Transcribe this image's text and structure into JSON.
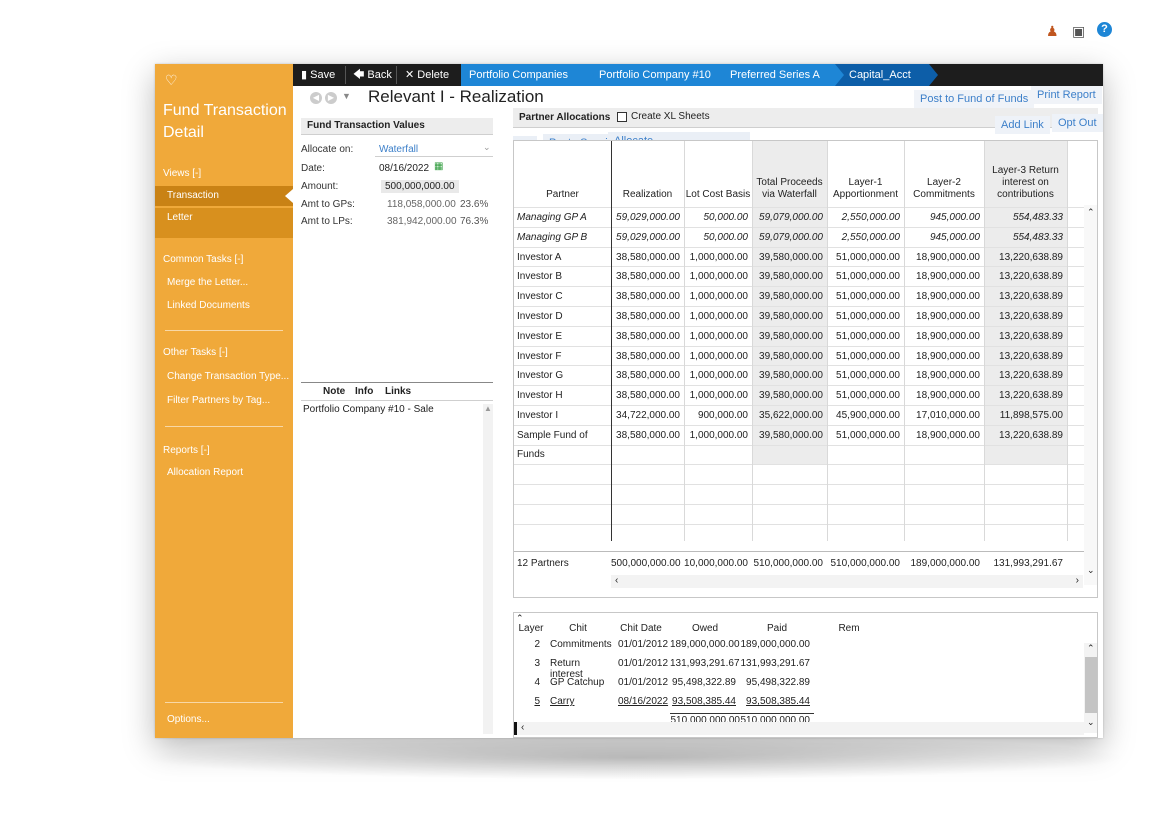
{
  "top_icons": {
    "user_icon": "person-icon",
    "camera_icon": "camera-icon",
    "help_icon": "help-icon"
  },
  "toolbar": {
    "save_label": "Save",
    "back_label": "Back",
    "delete_label": "Delete",
    "breadcrumbs": [
      "Portfolio Companies",
      "Portfolio Company #10",
      "Preferred Series A",
      "Capital_Acct"
    ]
  },
  "sidebar": {
    "title": "Fund Transaction Detail",
    "views_header": "Views [-]",
    "views": [
      "Transaction",
      "Letter"
    ],
    "common_header": "Common Tasks [-]",
    "common": [
      "Merge the Letter...",
      "Linked Documents"
    ],
    "other_header": "Other Tasks [-]",
    "other": [
      "Change Transaction Type...",
      "Filter Partners by Tag..."
    ],
    "reports_header": "Reports [-]",
    "reports": [
      "Allocation Report"
    ],
    "options": "Options..."
  },
  "header": {
    "title": "Relevant I - Realization"
  },
  "form": {
    "section_title": "Fund Transaction Values",
    "allocate_label": "Allocate on:",
    "allocate_value": "Waterfall",
    "date_label": "Date:",
    "date_value": "08/16/2022",
    "amount_label": "Amount:",
    "amount_value": "500,000,000.00",
    "gps_label": "Amt to GPs:",
    "gps_value": "118,058,000.00",
    "gps_pct": "23.6%",
    "lps_label": "Amt to LPs:",
    "lps_value": "381,942,000.00",
    "lps_pct": "76.3%"
  },
  "notes": {
    "tabs": [
      "Note",
      "Info",
      "Links"
    ],
    "items": [
      "Portfolio Company #10 - Sale"
    ]
  },
  "allocations": {
    "title": "Partner Allocations",
    "create_xl": "Create XL Sheets",
    "fx": "Fx",
    "paste_special": "Paste Special",
    "allocate": "Allocate",
    "post_to_fund": "Post to Fund of Funds",
    "print_report": "Print Report",
    "add_link": "Add Link",
    "opt_out": "Opt Out"
  },
  "grid": {
    "columns": [
      "Partner",
      "Realization",
      "Lot Cost Basis",
      "Total Proceeds via Waterfall",
      "Layer-1 Apportionment",
      "Layer-2 Commitments",
      "Layer-3 Return interest on contributions"
    ],
    "rows": [
      [
        "Managing GP A",
        "59,029,000.00",
        "50,000.00",
        "59,079,000.00",
        "2,550,000.00",
        "945,000.00",
        "554,483.33"
      ],
      [
        "Managing GP B",
        "59,029,000.00",
        "50,000.00",
        "59,079,000.00",
        "2,550,000.00",
        "945,000.00",
        "554,483.33"
      ],
      [
        "Investor A",
        "38,580,000.00",
        "1,000,000.00",
        "39,580,000.00",
        "51,000,000.00",
        "18,900,000.00",
        "13,220,638.89"
      ],
      [
        "Investor B",
        "38,580,000.00",
        "1,000,000.00",
        "39,580,000.00",
        "51,000,000.00",
        "18,900,000.00",
        "13,220,638.89"
      ],
      [
        "Investor C",
        "38,580,000.00",
        "1,000,000.00",
        "39,580,000.00",
        "51,000,000.00",
        "18,900,000.00",
        "13,220,638.89"
      ],
      [
        "Investor D",
        "38,580,000.00",
        "1,000,000.00",
        "39,580,000.00",
        "51,000,000.00",
        "18,900,000.00",
        "13,220,638.89"
      ],
      [
        "Investor E",
        "38,580,000.00",
        "1,000,000.00",
        "39,580,000.00",
        "51,000,000.00",
        "18,900,000.00",
        "13,220,638.89"
      ],
      [
        "Investor F",
        "38,580,000.00",
        "1,000,000.00",
        "39,580,000.00",
        "51,000,000.00",
        "18,900,000.00",
        "13,220,638.89"
      ],
      [
        "Investor G",
        "38,580,000.00",
        "1,000,000.00",
        "39,580,000.00",
        "51,000,000.00",
        "18,900,000.00",
        "13,220,638.89"
      ],
      [
        "Investor H",
        "38,580,000.00",
        "1,000,000.00",
        "39,580,000.00",
        "51,000,000.00",
        "18,900,000.00",
        "13,220,638.89"
      ],
      [
        "Investor I",
        "34,722,000.00",
        "900,000.00",
        "35,622,000.00",
        "45,900,000.00",
        "17,010,000.00",
        "11,898,575.00"
      ],
      [
        "Sample Fund of Funds",
        "38,580,000.00",
        "1,000,000.00",
        "39,580,000.00",
        "51,000,000.00",
        "18,900,000.00",
        "13,220,638.89"
      ]
    ],
    "totals": [
      "12 Partners",
      "500,000,000.00",
      "10,000,000.00",
      "510,000,000.00",
      "510,000,000.00",
      "189,000,000.00",
      "131,993,291.67"
    ]
  },
  "chits": {
    "columns": [
      "Layer",
      "Chit",
      "Chit Date",
      "Owed",
      "Paid",
      "Rem"
    ],
    "rows": [
      [
        "2",
        "Commitments",
        "01/01/2012",
        "189,000,000.00",
        "189,000,000.00",
        ""
      ],
      [
        "3",
        "Return interest",
        "01/01/2012",
        "131,993,291.67",
        "131,993,291.67",
        ""
      ],
      [
        "4",
        "GP Catchup",
        "01/01/2012",
        "95,498,322.89",
        "95,498,322.89",
        ""
      ],
      [
        "5",
        "Carry",
        "08/16/2022",
        "93,508,385.44",
        "93,508,385.44",
        ""
      ]
    ],
    "totals": [
      "510,000,000.00",
      "510,000,000.00"
    ]
  }
}
